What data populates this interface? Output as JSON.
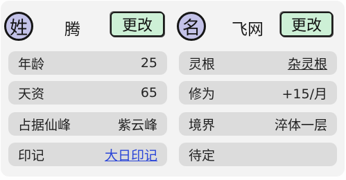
{
  "surname": {
    "badge": "姓",
    "value": "腾",
    "change_label": "更改"
  },
  "given_name": {
    "badge": "名",
    "value": "飞网",
    "change_label": "更改"
  },
  "left_rows": [
    {
      "label": "年龄",
      "value": "25"
    },
    {
      "label": "天资",
      "value": "65"
    },
    {
      "label": "占据仙峰",
      "value": "紫云峰"
    },
    {
      "label": "印记",
      "value": "大日印记"
    }
  ],
  "right_rows": [
    {
      "label": "灵根",
      "value": "杂灵根"
    },
    {
      "label": "修为",
      "value": "+15/月"
    },
    {
      "label": "境界",
      "value": "淬体一层"
    },
    {
      "label": "待定",
      "value": ""
    }
  ],
  "colors": {
    "badge_fill": "#c3c2e8",
    "button_fill": "#cdf0d6",
    "row_fill": "#dcdcdc",
    "link_blue": "#2a45d8"
  }
}
